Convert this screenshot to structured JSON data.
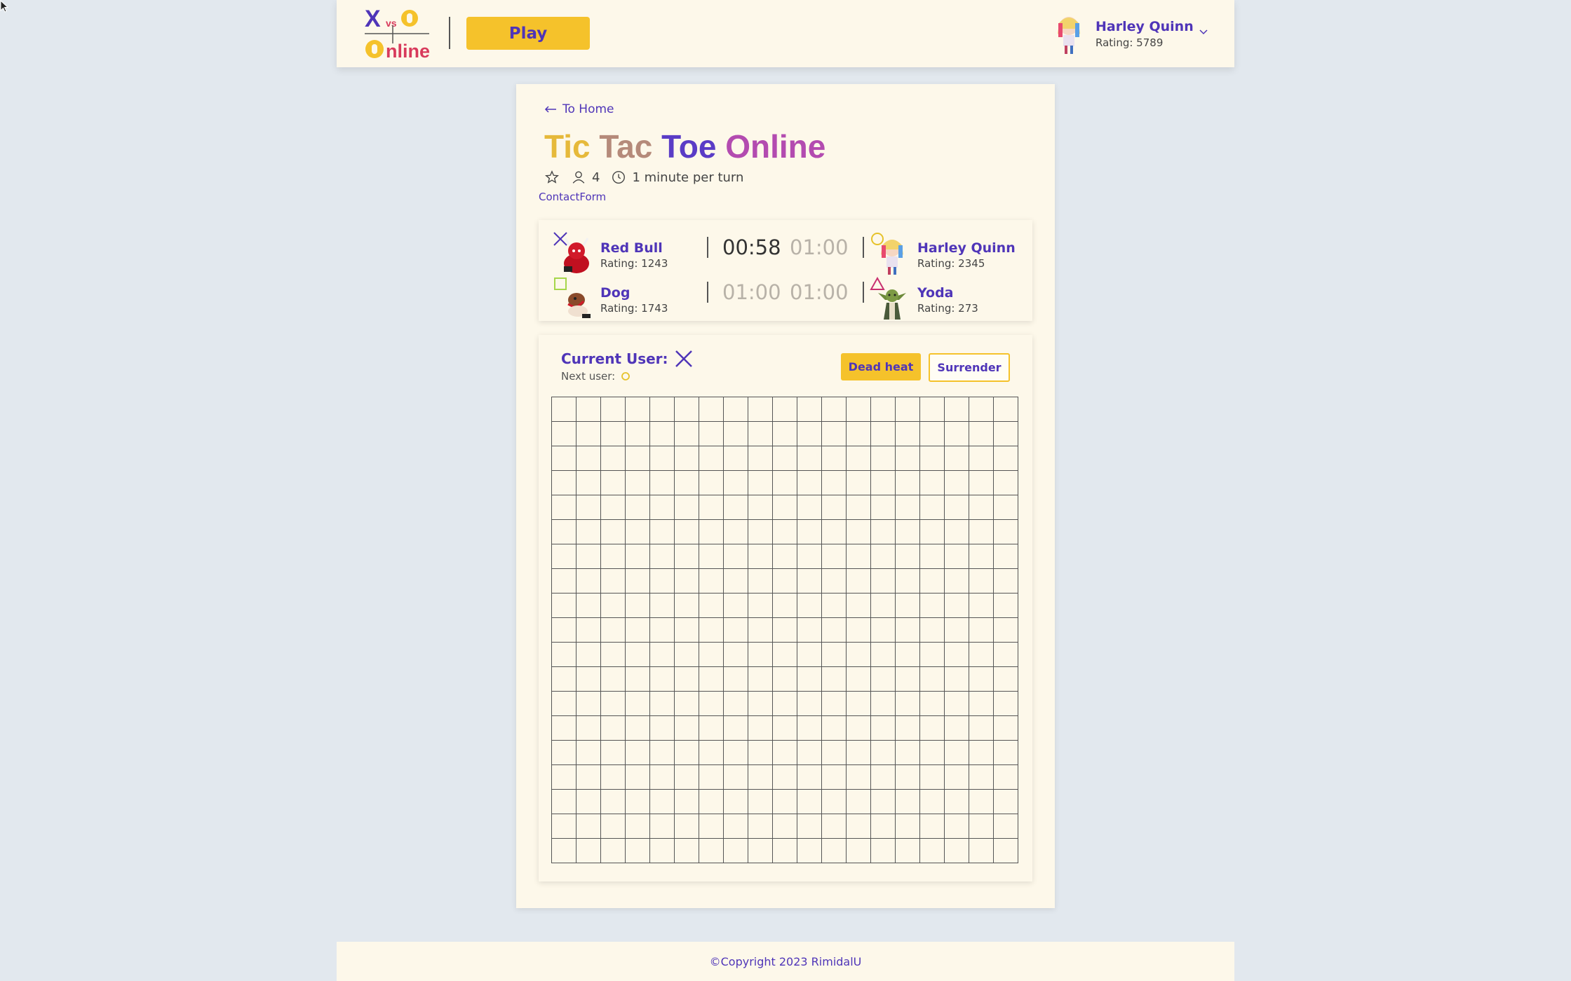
{
  "header": {
    "logo": {
      "x_letter": "X",
      "vs": "vs",
      "o_letter": "O",
      "online_o": "O",
      "online_rest": "nline"
    },
    "play_label": "Play",
    "user": {
      "name": "Harley Quinn",
      "rating": "Rating: 5789"
    }
  },
  "page": {
    "back_label": "To Home",
    "title_words": [
      "Tic",
      "Tac",
      "Toe",
      "Online"
    ],
    "players_count": "4",
    "turn_time": "1 minute per turn",
    "contact_label": "ContactForm"
  },
  "players": [
    {
      "name": "Red Bull",
      "rating": "Rating: 1243",
      "mark": "x-icon"
    },
    {
      "name": "Harley Quinn",
      "rating": "Rating: 2345",
      "mark": "circle-icon"
    },
    {
      "name": "Dog",
      "rating": "Rating: 1743",
      "mark": "square-icon"
    },
    {
      "name": "Yoda",
      "rating": "Rating: 273",
      "mark": "triangle-icon"
    }
  ],
  "timers": {
    "row1": {
      "left": "00:58",
      "right": "01:00"
    },
    "row2": {
      "left": "01:00",
      "right": "01:00"
    }
  },
  "game": {
    "current_label": "Current User:",
    "next_label": "Next user:",
    "dead_heat_label": "Dead heat",
    "surrender_label": "Surrender",
    "board": {
      "rows": 19,
      "cols": 19
    }
  },
  "footer": {
    "copyright": "©Copyright 2023 RimidalU"
  },
  "colors": {
    "accent": "#4f35b8",
    "yellow": "#f5c22b",
    "panel": "#fdf8ea",
    "background": "#e2e8ee",
    "x_mark": "#4f35b8",
    "o_mark": "#e6c22a",
    "square_mark": "#a6d64a",
    "triangle_mark": "#c8306f"
  }
}
